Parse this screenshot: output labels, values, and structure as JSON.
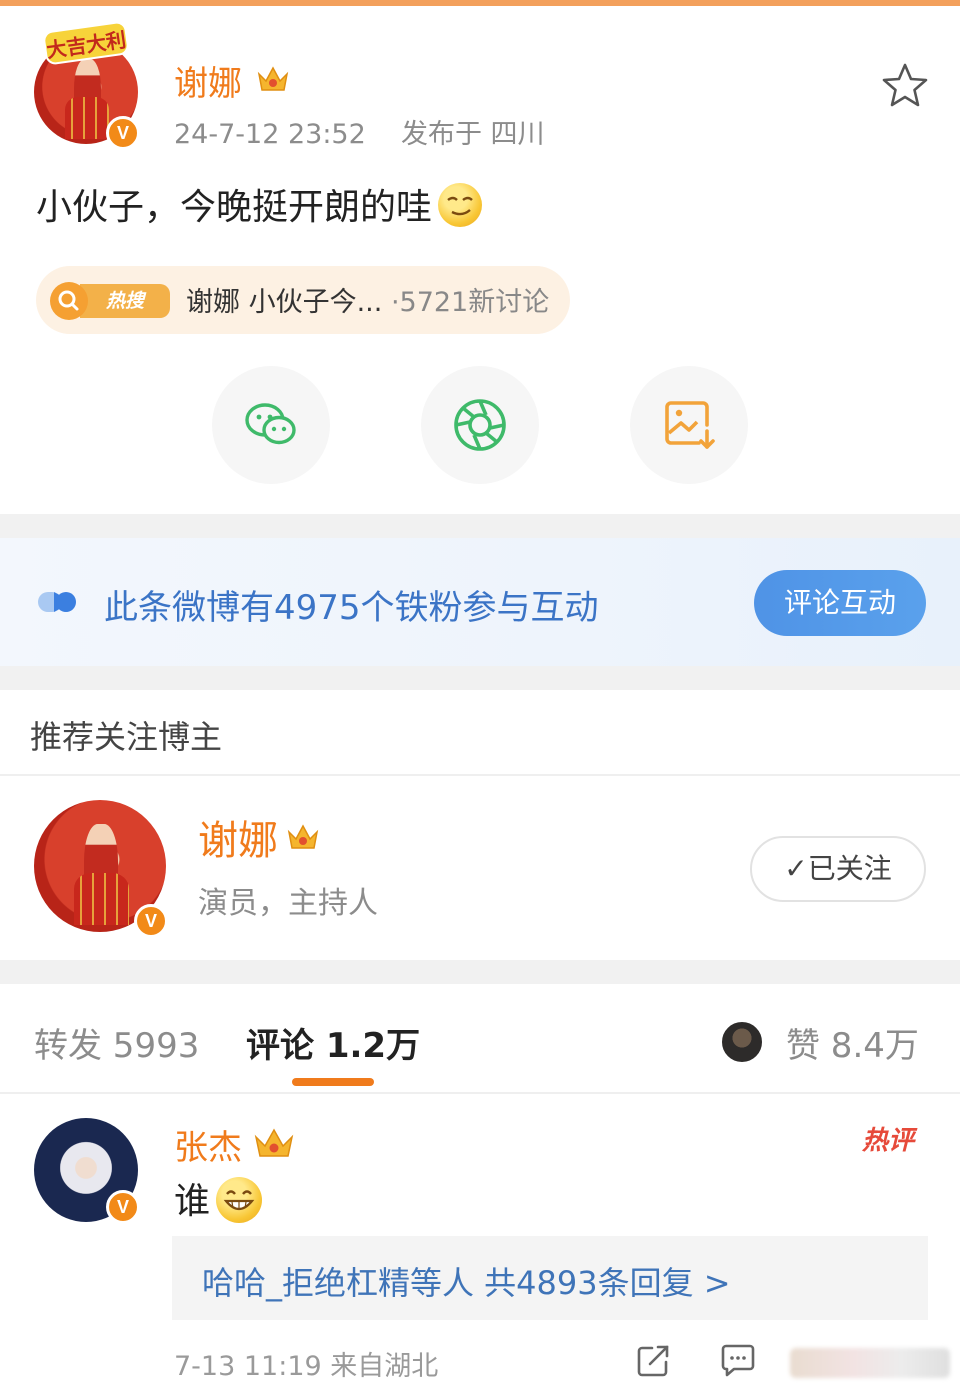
{
  "post": {
    "author": "谢娜",
    "time": "24-7-12 23:52",
    "location": "发布于 四川",
    "text": "小伙子，今晚挺开朗的哇",
    "avatar_sticker": "大吉大利",
    "hot_search": {
      "badge": "热搜",
      "topic": "谢娜 小伙子今...",
      "count": "·5721新讨论"
    },
    "share_icons": [
      "wechat-icon",
      "moments-icon",
      "save-image-icon"
    ]
  },
  "fan_banner": {
    "text": "此条微博有4975个铁粉参与互动",
    "button": "评论互动"
  },
  "recommend": {
    "title": "推荐关注博主",
    "name": "谢娜",
    "desc": "演员，主持人",
    "follow_label": "✓已关注"
  },
  "tabs": {
    "repost": "转发 5993",
    "comment": "评论 1.2万",
    "like": "赞 8.4万"
  },
  "comment": {
    "author": "张杰",
    "text": "谁",
    "badge": "热评",
    "replies": "哈哈_拒绝杠精等人  共4893条回复 >",
    "meta": "7-13 11:19  来自湖北"
  },
  "colors": {
    "accent": "#f07b1c",
    "link_blue": "#3b74c6",
    "hot_red": "#e64a3a"
  }
}
